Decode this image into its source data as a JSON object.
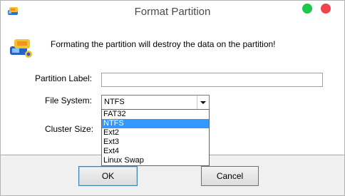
{
  "window": {
    "title": "Format Partition"
  },
  "dialog": {
    "warning": "Formating the partition will destroy the data on the partition!",
    "partition_label": {
      "label": "Partition Label:",
      "value": ""
    },
    "file_system": {
      "label": "File System:",
      "selected": "NTFS",
      "options": [
        "FAT32",
        "NTFS",
        "Ext2",
        "Ext3",
        "Ext4",
        "Linux Swap"
      ]
    },
    "cluster_size": {
      "label": "Cluster Size:"
    },
    "ok_label": "OK",
    "cancel_label": "Cancel"
  },
  "colors": {
    "close": "#ef4350",
    "maximize": "#1ec84a",
    "selection": "#3399ff"
  }
}
